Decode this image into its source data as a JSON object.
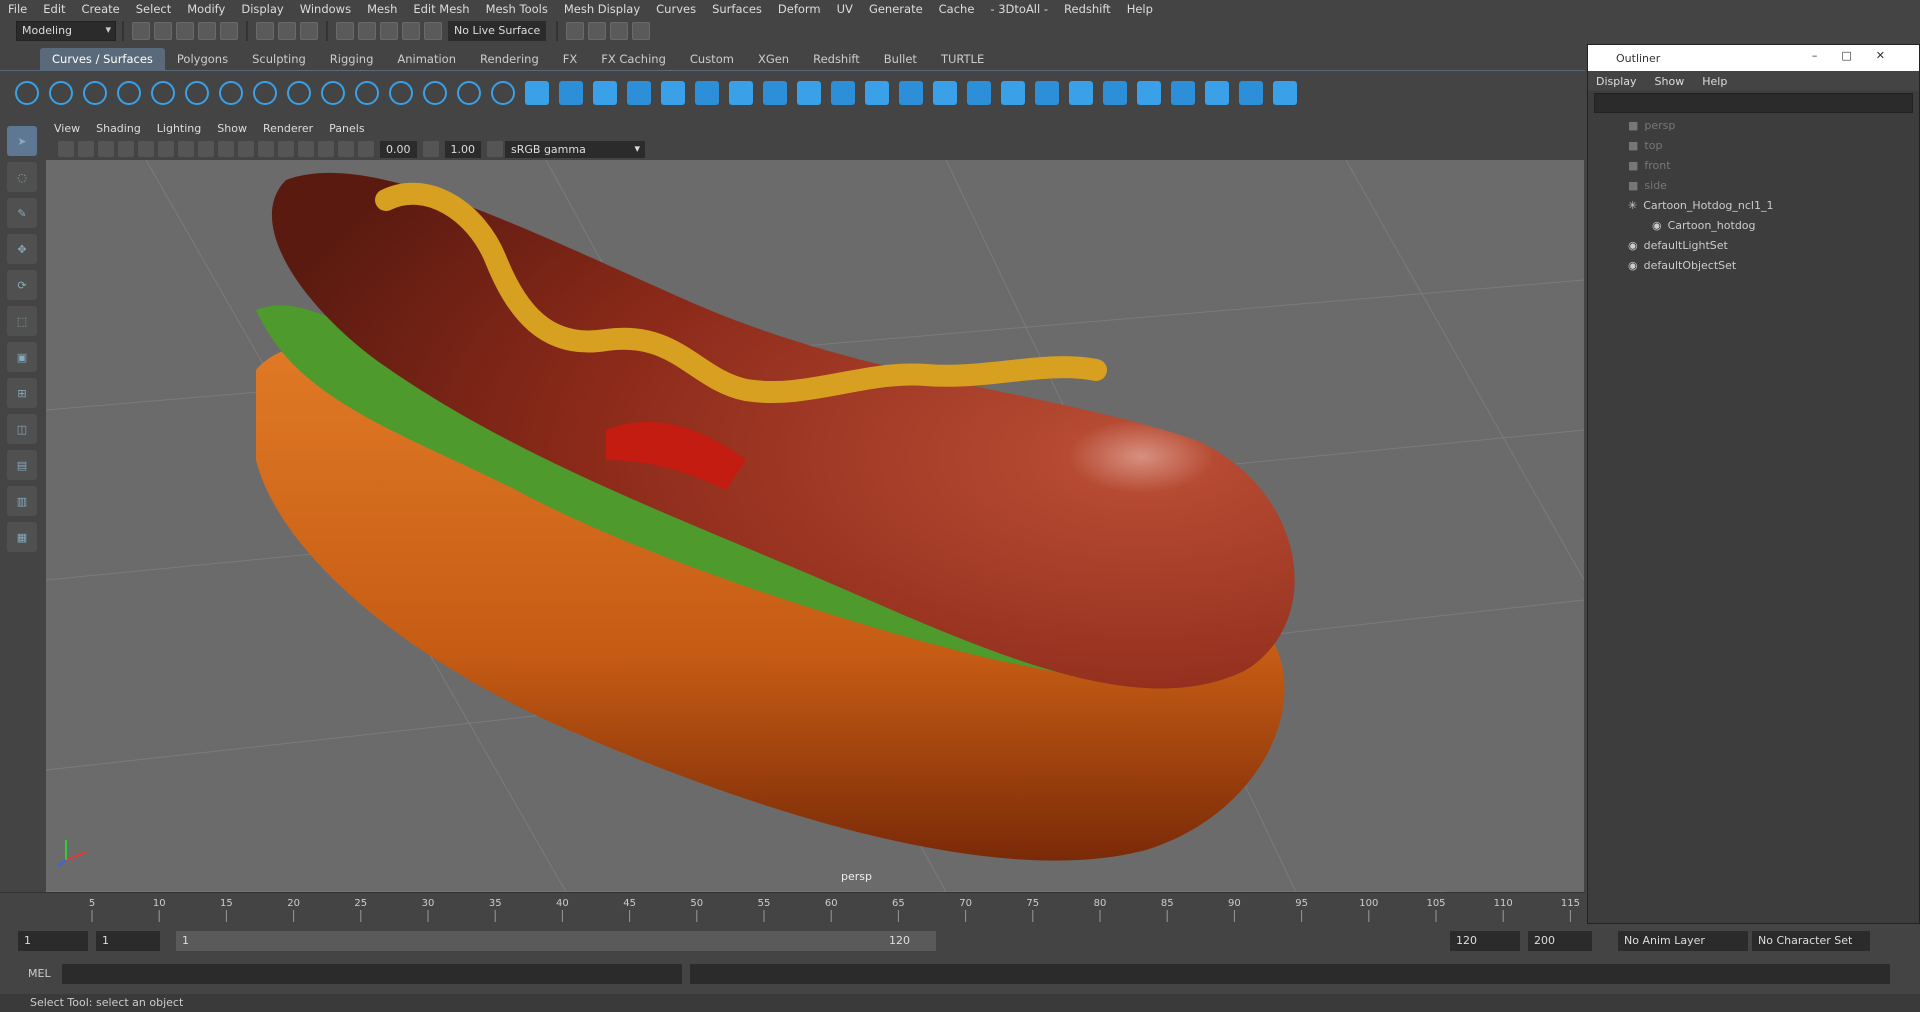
{
  "menubar": [
    "File",
    "Edit",
    "Create",
    "Select",
    "Modify",
    "Display",
    "Windows",
    "Mesh",
    "Edit Mesh",
    "Mesh Tools",
    "Mesh Display",
    "Curves",
    "Surfaces",
    "Deform",
    "UV",
    "Generate",
    "Cache",
    "- 3DtoAll -",
    "Redshift",
    "Help"
  ],
  "status": {
    "mode": "Modeling",
    "live_surface": "No Live Surface"
  },
  "shelf_tabs": [
    "Curves / Surfaces",
    "Polygons",
    "Sculpting",
    "Rigging",
    "Animation",
    "Rendering",
    "FX",
    "FX Caching",
    "Custom",
    "XGen",
    "Redshift",
    "Bullet",
    "TURTLE"
  ],
  "viewport": {
    "menu": [
      "View",
      "Shading",
      "Lighting",
      "Show",
      "Renderer",
      "Panels"
    ],
    "exposure": "0.00",
    "gamma": "1.00",
    "color_space": "sRGB gamma",
    "camera": "persp"
  },
  "outliner": {
    "title": "Outliner",
    "menu": [
      "Display",
      "Show",
      "Help"
    ],
    "items": [
      {
        "label": "persp",
        "dim": true
      },
      {
        "label": "top",
        "dim": true
      },
      {
        "label": "front",
        "dim": true
      },
      {
        "label": "side",
        "dim": true
      },
      {
        "label": "Cartoon_Hotdog_ncl1_1",
        "dim": false
      },
      {
        "label": "Cartoon_hotdog",
        "dim": false
      },
      {
        "label": "defaultLightSet",
        "dim": false
      },
      {
        "label": "defaultObjectSet",
        "dim": false
      }
    ]
  },
  "timeline": {
    "ticks": [
      "5",
      "10",
      "15",
      "20",
      "25",
      "30",
      "35",
      "40",
      "45",
      "50",
      "55",
      "60",
      "65",
      "70",
      "75",
      "80",
      "85",
      "90",
      "95",
      "100",
      "105",
      "110",
      "115"
    ],
    "current": "1"
  },
  "range": {
    "start": "1",
    "play_start": "1",
    "slider_start": "1",
    "slider_end": "120",
    "play_end": "120",
    "end": "200",
    "anim_layer": "No Anim Layer",
    "char_set": "No Character Set"
  },
  "cmd": {
    "label": "MEL"
  },
  "help": "Select Tool: select an object"
}
